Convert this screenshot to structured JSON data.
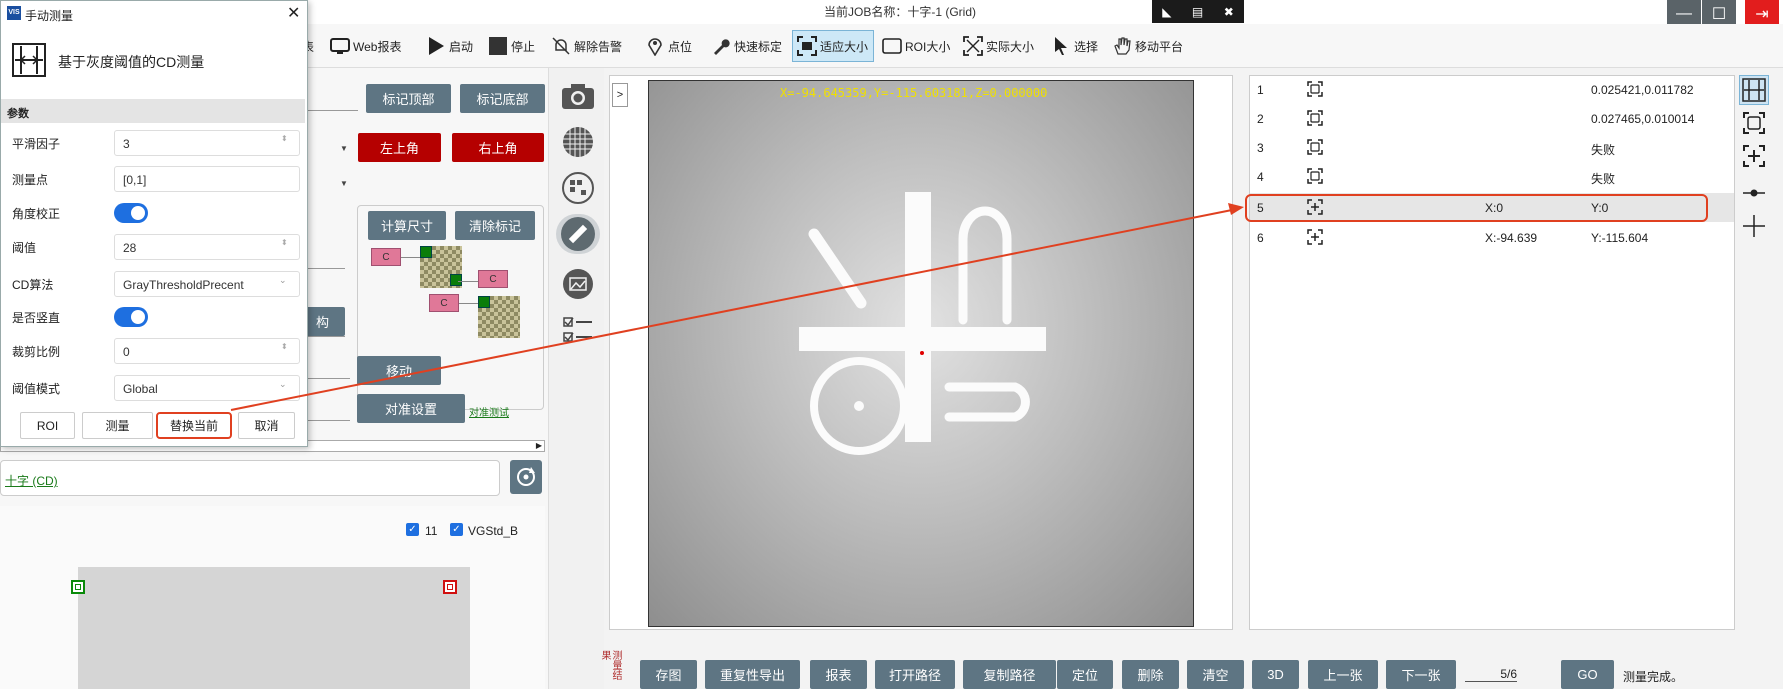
{
  "window": {
    "job_title": "当前JOB名称：十字-1 (Grid)",
    "remote_icons": [
      "cursor-icon",
      "keyboard-icon",
      "close-icon"
    ],
    "controls": [
      "minimize-icon",
      "maximize-icon",
      "exit-icon"
    ]
  },
  "toolbar": {
    "items": [
      {
        "label": "表",
        "icon": "report-icon"
      },
      {
        "label": "Web报表",
        "icon": "monitor-icon"
      },
      {
        "label": "启动",
        "icon": "play-icon"
      },
      {
        "label": "停止",
        "icon": "stop-icon"
      },
      {
        "label": "解除告警",
        "icon": "bell-off-icon"
      },
      {
        "label": "点位",
        "icon": "location-icon"
      },
      {
        "label": "快速标定",
        "icon": "wrench-icon"
      },
      {
        "label": "适应大小",
        "icon": "fit-icon"
      },
      {
        "label": "ROI大小",
        "icon": "roi-icon"
      },
      {
        "label": "实际大小",
        "icon": "expand-icon"
      },
      {
        "label": "选择",
        "icon": "pointer-icon"
      },
      {
        "label": "移动平台",
        "icon": "hand-icon"
      }
    ]
  },
  "dialog": {
    "logo_text": "VIS",
    "title": "手动测量",
    "heading": "基于灰度阈值的CD测量",
    "section": "参数",
    "fields": [
      {
        "label": "平滑因子",
        "value": "3",
        "type": "spin"
      },
      {
        "label": "测量点",
        "value": "[0,1]",
        "type": "text"
      },
      {
        "label": "角度校正",
        "value": "on",
        "type": "toggle"
      },
      {
        "label": "阈值",
        "value": "28",
        "type": "spin"
      },
      {
        "label": "CD算法",
        "value": "GrayThresholdPrecent",
        "type": "select"
      },
      {
        "label": "是否竖直",
        "value": "on",
        "type": "toggle"
      },
      {
        "label": "裁剪比例",
        "value": "0",
        "type": "spin"
      },
      {
        "label": "阈值模式",
        "value": "Global",
        "type": "select"
      }
    ],
    "buttons": [
      "ROI",
      "测量",
      "替换当前",
      "取消"
    ]
  },
  "left_panel": {
    "btn_mark_top": "标记顶部",
    "btn_mark_bottom": "标记底部",
    "btn_top_left": "左上角",
    "btn_top_right": "右上角",
    "btn_calc": "计算尺寸",
    "btn_clear": "清除标记",
    "chip_label": "C",
    "btn_partial": "构",
    "btn_move": "移动",
    "btn_align": "对准设置",
    "link_align_test": "对准测试",
    "recipe_link": "十字 (CD)",
    "check_1": "11",
    "check_2": "VGStd_B"
  },
  "image": {
    "coord_readout": "X=-94.645359,Y=-115.603181,Z=0.000000",
    "expand_label": ">"
  },
  "results": {
    "rows": [
      {
        "idx": "1",
        "icon": "roi-frame-icon",
        "c3": "",
        "c4": "0.025421,0.011782"
      },
      {
        "idx": "2",
        "icon": "roi-frame-icon",
        "c3": "",
        "c4": "0.027465,0.010014"
      },
      {
        "idx": "3",
        "icon": "roi-frame-icon",
        "c3": "",
        "c4": "失败"
      },
      {
        "idx": "4",
        "icon": "roi-frame-icon",
        "c3": "",
        "c4": "失败"
      },
      {
        "idx": "5",
        "icon": "crosshair-frame-icon",
        "c3": "X:0",
        "c4": "Y:0"
      },
      {
        "idx": "6",
        "icon": "crosshair-frame-icon",
        "c3": "X:-94.639",
        "c4": "Y:-115.604"
      }
    ],
    "selected_index": 4
  },
  "bottom": {
    "side_label": "测量结果",
    "buttons": [
      "存图",
      "重复性导出",
      "报表",
      "打开路径",
      "复制路径",
      "定位",
      "删除",
      "清空",
      "3D",
      "上一张",
      "下一张"
    ],
    "page": "5/6",
    "go": "GO",
    "status": "测量完成。"
  },
  "colors": {
    "accent_dark": "#5e7583",
    "danger": "#b50000",
    "highlight": "#e04020",
    "toggle": "#1e6fe0",
    "coord_text": "#f0e000"
  }
}
